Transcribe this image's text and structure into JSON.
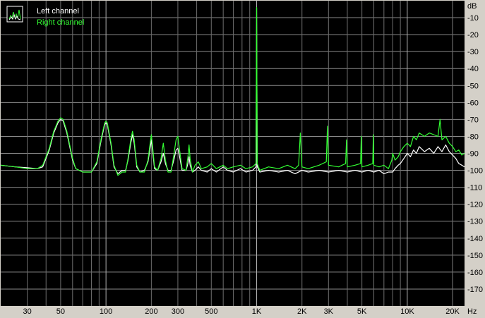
{
  "chart_data": {
    "type": "line",
    "x_scale": "log",
    "xlim": [
      20,
      24000
    ],
    "ylim": [
      -180,
      0
    ],
    "xlabel": "Hz",
    "ylabel": "dB",
    "grid": true,
    "legend_position": "top-left",
    "x_ticks": [
      {
        "value": 30,
        "label": "30"
      },
      {
        "value": 50,
        "label": "50"
      },
      {
        "value": 100,
        "label": "100"
      },
      {
        "value": 200,
        "label": "200"
      },
      {
        "value": 300,
        "label": "300"
      },
      {
        "value": 500,
        "label": "500"
      },
      {
        "value": 1000,
        "label": "1K"
      },
      {
        "value": 2000,
        "label": "2K"
      },
      {
        "value": 3000,
        "label": "3K"
      },
      {
        "value": 5000,
        "label": "5K"
      },
      {
        "value": 10000,
        "label": "10K"
      },
      {
        "value": 20000,
        "label": "20K"
      }
    ],
    "y_ticks": [
      {
        "value": -10,
        "label": "-10"
      },
      {
        "value": -20,
        "label": "-20"
      },
      {
        "value": -30,
        "label": "-30"
      },
      {
        "value": -40,
        "label": "-40"
      },
      {
        "value": -50,
        "label": "-50"
      },
      {
        "value": -60,
        "label": "-60"
      },
      {
        "value": -70,
        "label": "-70"
      },
      {
        "value": -80,
        "label": "-80"
      },
      {
        "value": -90,
        "label": "-90"
      },
      {
        "value": -100,
        "label": "-100"
      },
      {
        "value": -110,
        "label": "-110"
      },
      {
        "value": -120,
        "label": "-120"
      },
      {
        "value": -130,
        "label": "-130"
      },
      {
        "value": -140,
        "label": "-140"
      },
      {
        "value": -150,
        "label": "-150"
      },
      {
        "value": -160,
        "label": "-160"
      },
      {
        "value": -170,
        "label": "-170"
      }
    ],
    "series": [
      {
        "name": "Left channel",
        "color": "#ffffff",
        "points": [
          [
            20,
            -97
          ],
          [
            25,
            -98
          ],
          [
            30,
            -98.5
          ],
          [
            35,
            -99
          ],
          [
            38,
            -98
          ],
          [
            42,
            -88
          ],
          [
            45,
            -78
          ],
          [
            48,
            -72
          ],
          [
            50,
            -70
          ],
          [
            52,
            -71
          ],
          [
            55,
            -78
          ],
          [
            60,
            -94
          ],
          [
            63,
            -99
          ],
          [
            70,
            -101
          ],
          [
            80,
            -101
          ],
          [
            87,
            -96
          ],
          [
            93,
            -82
          ],
          [
            98,
            -73
          ],
          [
            100,
            -72
          ],
          [
            102,
            -73
          ],
          [
            108,
            -85
          ],
          [
            113,
            -98
          ],
          [
            120,
            -102
          ],
          [
            128,
            -100
          ],
          [
            135,
            -100
          ],
          [
            140,
            -94
          ],
          [
            146,
            -84
          ],
          [
            150,
            -79
          ],
          [
            154,
            -84
          ],
          [
            160,
            -98
          ],
          [
            168,
            -101
          ],
          [
            180,
            -100
          ],
          [
            190,
            -95
          ],
          [
            197,
            -86
          ],
          [
            200,
            -82
          ],
          [
            203,
            -87
          ],
          [
            210,
            -99
          ],
          [
            220,
            -100
          ],
          [
            232,
            -95
          ],
          [
            240,
            -90
          ],
          [
            248,
            -96
          ],
          [
            258,
            -100
          ],
          [
            270,
            -100
          ],
          [
            282,
            -94
          ],
          [
            292,
            -88
          ],
          [
            300,
            -87
          ],
          [
            308,
            -92
          ],
          [
            320,
            -100
          ],
          [
            340,
            -100
          ],
          [
            350,
            -96
          ],
          [
            356,
            -92
          ],
          [
            362,
            -97
          ],
          [
            375,
            -101
          ],
          [
            390,
            -100
          ],
          [
            410,
            -98
          ],
          [
            430,
            -100
          ],
          [
            470,
            -101
          ],
          [
            500,
            -99
          ],
          [
            540,
            -101
          ],
          [
            600,
            -98
          ],
          [
            640,
            -100
          ],
          [
            700,
            -101
          ],
          [
            780,
            -99
          ],
          [
            850,
            -101
          ],
          [
            940,
            -100
          ],
          [
            990,
            -98
          ],
          [
            1000,
            -4
          ],
          [
            1010,
            -98
          ],
          [
            1050,
            -101
          ],
          [
            1200,
            -100
          ],
          [
            1400,
            -101
          ],
          [
            1600,
            -100
          ],
          [
            1800,
            -102
          ],
          [
            2000,
            -100
          ],
          [
            2200,
            -101
          ],
          [
            2600,
            -100
          ],
          [
            3000,
            -101
          ],
          [
            3500,
            -100
          ],
          [
            4000,
            -101
          ],
          [
            4500,
            -100
          ],
          [
            5000,
            -101
          ],
          [
            5500,
            -100
          ],
          [
            6000,
            -101
          ],
          [
            6500,
            -100
          ],
          [
            7000,
            -102
          ],
          [
            7500,
            -101
          ],
          [
            8000,
            -101
          ],
          [
            8300,
            -99
          ],
          [
            8700,
            -97
          ],
          [
            9000,
            -96
          ],
          [
            9500,
            -93
          ],
          [
            10000,
            -90
          ],
          [
            10500,
            -92
          ],
          [
            11000,
            -88
          ],
          [
            11500,
            -90
          ],
          [
            12000,
            -86
          ],
          [
            13000,
            -89
          ],
          [
            14000,
            -87
          ],
          [
            15000,
            -90
          ],
          [
            16000,
            -86
          ],
          [
            17000,
            -89
          ],
          [
            18000,
            -85
          ],
          [
            19000,
            -89
          ],
          [
            20000,
            -91
          ],
          [
            21000,
            -93
          ],
          [
            22000,
            -96
          ],
          [
            23000,
            -97
          ],
          [
            24000,
            -98
          ]
        ]
      },
      {
        "name": "Right channel",
        "color": "#33ff33",
        "points": [
          [
            20,
            -97
          ],
          [
            25,
            -98
          ],
          [
            30,
            -99
          ],
          [
            35,
            -99
          ],
          [
            38,
            -97
          ],
          [
            42,
            -87
          ],
          [
            45,
            -77
          ],
          [
            48,
            -71
          ],
          [
            50,
            -69
          ],
          [
            52,
            -70
          ],
          [
            55,
            -77
          ],
          [
            60,
            -93
          ],
          [
            63,
            -99
          ],
          [
            70,
            -101
          ],
          [
            80,
            -101
          ],
          [
            87,
            -95
          ],
          [
            93,
            -81
          ],
          [
            98,
            -72
          ],
          [
            100,
            -71
          ],
          [
            102,
            -72
          ],
          [
            108,
            -84
          ],
          [
            113,
            -97
          ],
          [
            120,
            -103
          ],
          [
            128,
            -101
          ],
          [
            135,
            -101
          ],
          [
            140,
            -93
          ],
          [
            146,
            -82
          ],
          [
            150,
            -77
          ],
          [
            154,
            -82
          ],
          [
            160,
            -97
          ],
          [
            168,
            -101
          ],
          [
            180,
            -101
          ],
          [
            190,
            -94
          ],
          [
            197,
            -83
          ],
          [
            200,
            -79
          ],
          [
            203,
            -84
          ],
          [
            210,
            -98
          ],
          [
            220,
            -100
          ],
          [
            232,
            -93
          ],
          [
            240,
            -84
          ],
          [
            248,
            -94
          ],
          [
            258,
            -101
          ],
          [
            270,
            -101
          ],
          [
            282,
            -91
          ],
          [
            292,
            -82
          ],
          [
            300,
            -80
          ],
          [
            308,
            -88
          ],
          [
            320,
            -99
          ],
          [
            340,
            -100
          ],
          [
            350,
            -92
          ],
          [
            356,
            -85
          ],
          [
            362,
            -93
          ],
          [
            375,
            -101
          ],
          [
            390,
            -97
          ],
          [
            410,
            -95
          ],
          [
            430,
            -99
          ],
          [
            470,
            -98
          ],
          [
            500,
            -96
          ],
          [
            540,
            -99
          ],
          [
            600,
            -97
          ],
          [
            640,
            -99
          ],
          [
            700,
            -98
          ],
          [
            780,
            -97
          ],
          [
            850,
            -99
          ],
          [
            940,
            -98
          ],
          [
            990,
            -96
          ],
          [
            1000,
            -4
          ],
          [
            1010,
            -96
          ],
          [
            1050,
            -100
          ],
          [
            1200,
            -98
          ],
          [
            1400,
            -99
          ],
          [
            1600,
            -97
          ],
          [
            1800,
            -99
          ],
          [
            1900,
            -97
          ],
          [
            1950,
            -78
          ],
          [
            2000,
            -98
          ],
          [
            2200,
            -99
          ],
          [
            2600,
            -97
          ],
          [
            2900,
            -95
          ],
          [
            2950,
            -74
          ],
          [
            3000,
            -97
          ],
          [
            3500,
            -98
          ],
          [
            3900,
            -96
          ],
          [
            3950,
            -82
          ],
          [
            4000,
            -98
          ],
          [
            4500,
            -97
          ],
          [
            4900,
            -96
          ],
          [
            4950,
            -80
          ],
          [
            5000,
            -98
          ],
          [
            5500,
            -97
          ],
          [
            5900,
            -96
          ],
          [
            5950,
            -79
          ],
          [
            6000,
            -97
          ],
          [
            6500,
            -98
          ],
          [
            7000,
            -97
          ],
          [
            7500,
            -99
          ],
          [
            7900,
            -94
          ],
          [
            8000,
            -90
          ],
          [
            8300,
            -94
          ],
          [
            8700,
            -92
          ],
          [
            9000,
            -89
          ],
          [
            9500,
            -86
          ],
          [
            10000,
            -84
          ],
          [
            10500,
            -86
          ],
          [
            11000,
            -80
          ],
          [
            11500,
            -82
          ],
          [
            12000,
            -78
          ],
          [
            13000,
            -80
          ],
          [
            14000,
            -78
          ],
          [
            15000,
            -79
          ],
          [
            16000,
            -80
          ],
          [
            16500,
            -70
          ],
          [
            17000,
            -82
          ],
          [
            18000,
            -80
          ],
          [
            19000,
            -84
          ],
          [
            20000,
            -86
          ],
          [
            21000,
            -89
          ],
          [
            22000,
            -88
          ],
          [
            23000,
            -91
          ],
          [
            24000,
            -90
          ]
        ]
      }
    ]
  }
}
